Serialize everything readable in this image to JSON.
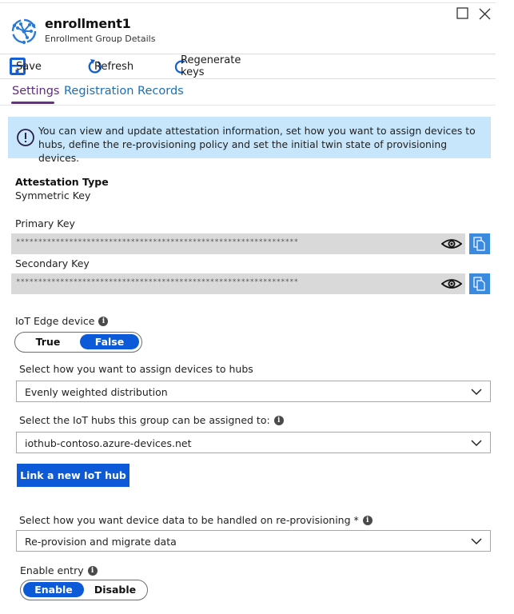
{
  "header": {
    "title": "enrollment1",
    "subtitle": "Enrollment Group Details",
    "icon": "iot-hub-dps-icon",
    "window_controls": [
      "maximize-icon",
      "close-icon"
    ]
  },
  "toolbar": {
    "save_label": "Save",
    "refresh_label": "Refresh",
    "regenerate_label": "Regenerate keys"
  },
  "tabs": [
    {
      "label": "Settings",
      "active": true
    },
    {
      "label": "Registration Records",
      "active": false
    }
  ],
  "banner": {
    "icon": "info-circle-icon",
    "text": "You can view and update attestation information, set how you want to assign devices to hubs, define the re-provisioning policy and set the initial twin state of provisioning devices."
  },
  "attestation": {
    "label": "Attestation Type",
    "value": "Symmetric Key"
  },
  "primary_key": {
    "label": "Primary Key",
    "masked_value": "****************************************************************"
  },
  "secondary_key": {
    "label": "Secondary Key",
    "masked_value": "****************************************************************"
  },
  "iot_edge": {
    "label": "IoT Edge device",
    "options": [
      "True",
      "False"
    ],
    "selected": "False"
  },
  "allocation": {
    "label": "Select how you want to assign devices to hubs",
    "value": "Evenly weighted distribution"
  },
  "hubs": {
    "label": "Select the IoT hubs this group can be assigned to:",
    "value": "iothub-contoso.azure-devices.net",
    "link_button": "Link a new IoT hub"
  },
  "reprovision": {
    "label": "Select how you want device data to be handled on re-provisioning *",
    "value": "Re-provision and migrate data"
  },
  "enable_entry": {
    "label": "Enable entry",
    "options": [
      "Enable",
      "Disable"
    ],
    "selected": "Enable"
  },
  "colors": {
    "accent_blue": "#0c5ad8",
    "tab_active": "#5c2d79",
    "tab_link": "#1a6fb4",
    "banner_bg": "#c7e6fb",
    "copy_button": "#3a8be0"
  }
}
